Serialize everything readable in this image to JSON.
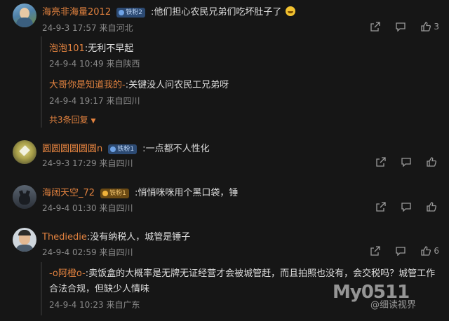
{
  "comments": [
    {
      "username": "海亮非海量2012",
      "badge": "铁粉2",
      "text": "他们担心农民兄弟们吃坏肚子了",
      "time": "24-9-3 17:57",
      "location": "来自河北",
      "likes": "3",
      "replies": [
        {
          "username": "泡泡101",
          "text": "无利不早起",
          "time": "24-9-4 10:49",
          "location": "来自陕西"
        },
        {
          "username": "大哥你是知道我的-",
          "text": "关键没人问农民工兄弟呀",
          "time": "24-9-4 19:17",
          "location": "来自四川"
        }
      ],
      "more_replies": "共3条回复"
    },
    {
      "username": "圆圆圆圆圆圆n",
      "badge": "铁粉1",
      "text": "一点都不人性化",
      "time": "24-9-3 17:29",
      "location": "来自四川",
      "likes": ""
    },
    {
      "username": "海阔天空_72",
      "badge": "铁粉1",
      "text": "悄悄咪咪用个黑口袋，锤",
      "time": "24-9-4 01:30",
      "location": "来自四川",
      "likes": ""
    },
    {
      "username": "Thediedie",
      "text": "没有纳税人，城管是锤子",
      "time": "24-9-4 02:59",
      "location": "来自四川",
      "likes": "6",
      "replies": [
        {
          "username": "-o阿橙o-",
          "text": "卖饭盒的大概率是无牌无证经营才会被城管赶，而且拍照也没有，会交税吗？城管工作合法合规，但缺少人情味",
          "time": "24-9-4 10:23",
          "location": "来自广东"
        }
      ]
    }
  ],
  "watermark": {
    "site": "My0511",
    "account": "@细读视界"
  },
  "icons": [
    "share-icon",
    "comment-icon",
    "like-icon",
    "chevron-down-icon"
  ]
}
